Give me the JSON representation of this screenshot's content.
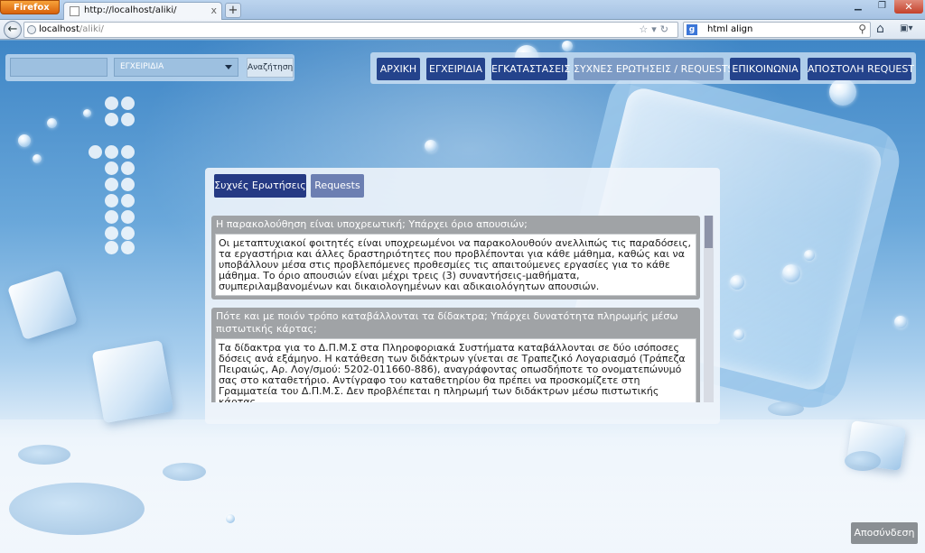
{
  "browser": {
    "app_button": "Firefox",
    "tab_title": "http://localhost/aliki/",
    "tab_close": "x",
    "new_tab": "+",
    "url_host": "localhost",
    "url_path": "/aliki/",
    "search_text": "html align",
    "search_engine_badge": "g"
  },
  "site": {
    "search_input_value": "",
    "guide_select_value": "ΕΓΧΕΙΡΙΔΙΑ",
    "search_button": "Αναζήτηση",
    "menu": [
      {
        "label": "ΑΡΧΙΚΗ"
      },
      {
        "label": "ΕΓΧΕΙΡΙΔΙΑ"
      },
      {
        "label": "ΕΓΚΑΤΑΣΤΑΣΕΙΣ"
      },
      {
        "label": "ΣΥΧΝΕΣ ΕΡΩΤΗΣΕΙΣ / REQUESTS"
      },
      {
        "label": "ΕΠΙΚΟΙΝΩΝΙΑ"
      },
      {
        "label": "ΑΠΟΣΤΟΛΗ REQUEST"
      }
    ],
    "logout": "Αποσύνδεση"
  },
  "content": {
    "tabs": [
      {
        "label": "Συχνές Ερωτήσεις"
      },
      {
        "label": "Requests"
      }
    ],
    "faq": [
      {
        "question": "Η παρακολούθηση είναι υποχρεωτική; Υπάρχει όριο απουσιών;",
        "answer": "Οι μεταπτυχιακοί φοιτητές είναι υποχρεωμένοι να παρακολουθούν ανελλιπώς τις παραδόσεις, τα εργαστήρια και άλλες δραστηριότητες που προβλέπονται για κάθε μάθημα, καθώς και να υποβάλλουν μέσα στις προβλεπόμενες προθεσμίες τις απαιτούμενες εργασίες για το κάθε μάθημα. Το όριο απουσιών είναι μέχρι τρεις (3) συναντήσεις-μαθήματα, συμπεριλαμβανομένων και δικαιολογημένων και αδικαιολόγητων απουσιών."
      },
      {
        "question": "Πότε και με ποιόν τρόπο καταβάλλονται τα δίδακτρα; Υπάρχει δυνατότητα πληρωμής μέσω πιστωτικής κάρτας;",
        "answer": "Τα δίδακτρα για το Δ.Π.Μ.Σ στα Πληροφοριακά Συστήματα καταβάλλονται σε δύο ισόποσες δόσεις ανά εξάμηνο. Η κατάθεση των διδάκτρων γίνεται σε Τραπεζικό Λογαριασμό (Τράπεζα Πειραιώς, Αρ. Λογ/σμού: 5202-011660-886), αναγράφοντας οπωσδήποτε το ονοματεπώνυμό σας στο καταθετήριο. Αντίγραφο του καταθετηρίου θα πρέπει να προσκομίζετε στη Γραμματεία του Δ.Π.Μ.Σ. Δεν προβλέπεται η πληρωμή των διδάκτρων μέσω πιστωτικής κάρτας."
      }
    ]
  }
}
